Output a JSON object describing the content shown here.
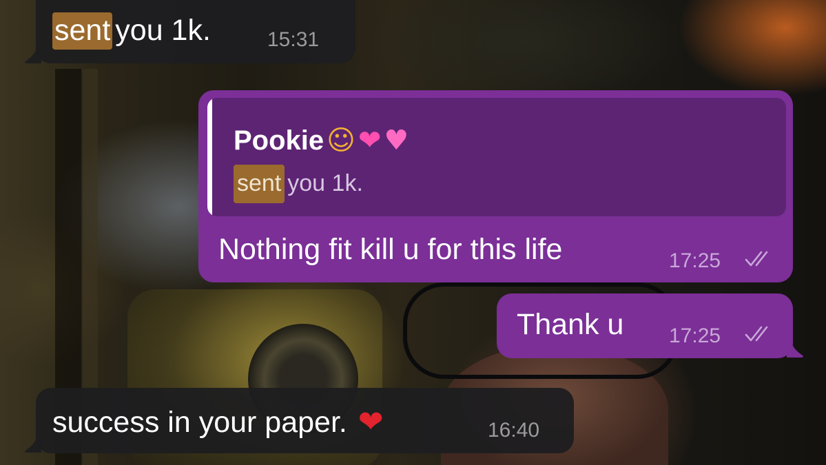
{
  "messages": [
    {
      "direction": "incoming",
      "highlight": "sent",
      "text": "you 1k.",
      "time": "15:31"
    },
    {
      "direction": "outgoing",
      "reply": {
        "sender": "Pookie",
        "sender_emojis": [
          "kissing-face-emoji",
          "sparkling-heart-emoji",
          "two-hearts-emoji"
        ],
        "highlight": "sent",
        "text": "you 1k."
      },
      "text": "Nothing fit kill u for this life",
      "time": "17:25",
      "status": "read"
    },
    {
      "direction": "outgoing",
      "text": "Thank u",
      "time": "17:25",
      "status": "read"
    },
    {
      "direction": "incoming",
      "text": "success in your paper.",
      "emoji": "red-heart-emoji",
      "time": "16:40"
    }
  ],
  "colors": {
    "incoming_bubble": "#1e1e20",
    "outgoing_bubble": "#7b2f97",
    "quote_background": "#5d2474",
    "highlight": "#9a6a2e"
  }
}
